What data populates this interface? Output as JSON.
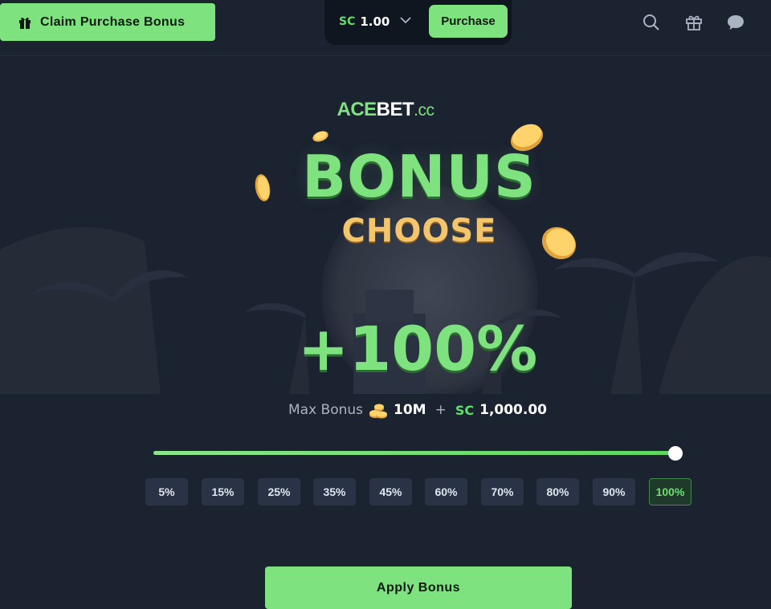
{
  "topbar": {
    "claim_label": "Claim Purchase Bonus",
    "currency_code": "SC",
    "currency_value": "1.00",
    "purchase_label": "Purchase",
    "icons": [
      "search-icon",
      "gift-icon",
      "chat-icon"
    ]
  },
  "hero": {
    "logo_ace": "ACE",
    "logo_bet": "BET",
    "logo_cc": ".cc",
    "bonus_text": "BONUS",
    "choose_text": "CHOOSE"
  },
  "bonus": {
    "percent_display": "+100%",
    "max_label": "Max Bonus",
    "coin_amount": "10M",
    "plus": "+",
    "sc_code": "SC",
    "sc_amount": "1,000.00",
    "slider_value_percent": 100
  },
  "percent_options": [
    {
      "label": "5%",
      "active": false
    },
    {
      "label": "15%",
      "active": false
    },
    {
      "label": "25%",
      "active": false
    },
    {
      "label": "35%",
      "active": false
    },
    {
      "label": "45%",
      "active": false
    },
    {
      "label": "60%",
      "active": false
    },
    {
      "label": "70%",
      "active": false
    },
    {
      "label": "80%",
      "active": false
    },
    {
      "label": "90%",
      "active": false
    },
    {
      "label": "100%",
      "active": true
    }
  ],
  "apply_label": "Apply Bonus",
  "colors": {
    "accent": "#7ee37e",
    "background": "#1b2230",
    "gold": "#f3c56c"
  }
}
